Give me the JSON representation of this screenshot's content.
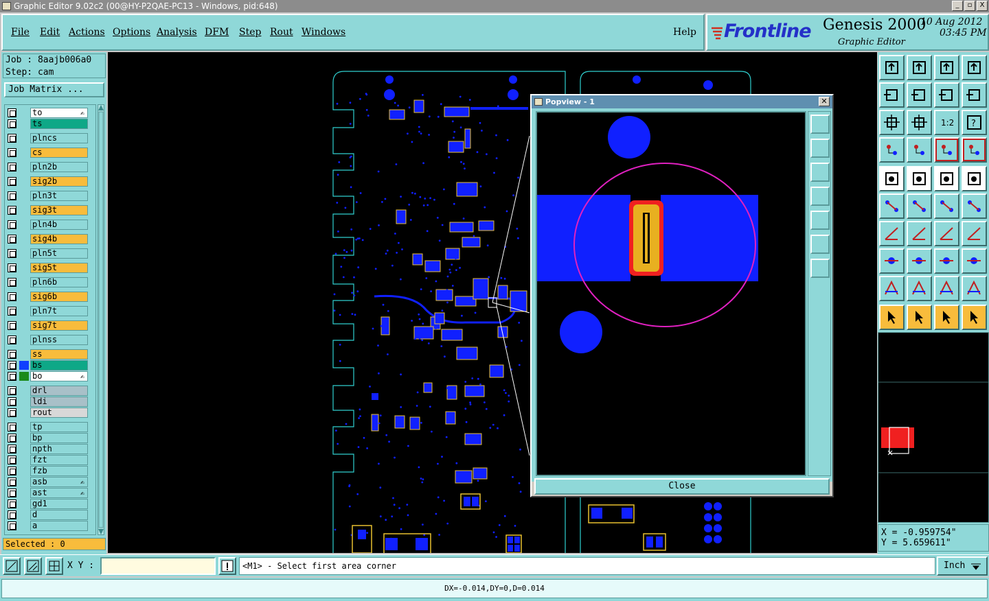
{
  "window": {
    "title": "Graphic Editor 9.02c2 (00@HY-P2QAE-PC13 - Windows, pid:648)",
    "controls": [
      "_",
      "▫",
      "X"
    ]
  },
  "menubar": {
    "items": [
      "File",
      "Edit",
      "Actions",
      "Options",
      "Analysis",
      "DFM",
      "Step",
      "Rout",
      "Windows"
    ],
    "help": "Help"
  },
  "brand": {
    "logo": "Frontline",
    "product": "Genesis 2000",
    "subtitle": "Graphic Editor",
    "date": "10 Aug 2012",
    "time": "03:45 PM"
  },
  "job": {
    "job_line": "Job : 8aajb006a0",
    "step_line": "Step: cam",
    "matrix_button": "Job Matrix ..."
  },
  "layers": [
    {
      "name": "to",
      "color": "#ffffff",
      "swatch": "",
      "mark": "✍"
    },
    {
      "name": "ts",
      "color": "#0ea887",
      "swatch": "",
      "mark": ""
    },
    {
      "name": "plncs",
      "color": "#8fd8d8",
      "swatch": "",
      "mark": ""
    },
    {
      "name": "cs",
      "color": "#f8bc3c",
      "swatch": "",
      "mark": ""
    },
    {
      "name": "pln2b",
      "color": "#8fd8d8",
      "swatch": "",
      "mark": ""
    },
    {
      "name": "sig2b",
      "color": "#f8bc3c",
      "swatch": "",
      "mark": ""
    },
    {
      "name": "pln3t",
      "color": "#8fd8d8",
      "swatch": "",
      "mark": ""
    },
    {
      "name": "sig3t",
      "color": "#f8bc3c",
      "swatch": "",
      "mark": ""
    },
    {
      "name": "pln4b",
      "color": "#8fd8d8",
      "swatch": "",
      "mark": ""
    },
    {
      "name": "sig4b",
      "color": "#f8bc3c",
      "swatch": "",
      "mark": ""
    },
    {
      "name": "pln5t",
      "color": "#8fd8d8",
      "swatch": "",
      "mark": ""
    },
    {
      "name": "sig5t",
      "color": "#f8bc3c",
      "swatch": "",
      "mark": ""
    },
    {
      "name": "pln6b",
      "color": "#8fd8d8",
      "swatch": "",
      "mark": ""
    },
    {
      "name": "sig6b",
      "color": "#f8bc3c",
      "swatch": "",
      "mark": ""
    },
    {
      "name": "pln7t",
      "color": "#8fd8d8",
      "swatch": "",
      "mark": ""
    },
    {
      "name": "sig7t",
      "color": "#f8bc3c",
      "swatch": "",
      "mark": ""
    },
    {
      "name": "plnss",
      "color": "#8fd8d8",
      "swatch": "",
      "mark": ""
    },
    {
      "name": "ss",
      "color": "#f8bc3c",
      "swatch": "",
      "mark": ""
    },
    {
      "name": "bs",
      "color": "#0ea887",
      "swatch": "#1040ff",
      "mark": ""
    },
    {
      "name": "bo",
      "color": "#ffffff",
      "swatch": "#1a8a1a",
      "mark": "✍"
    },
    {
      "name": "drl",
      "color": "#a8c0c8",
      "swatch": "",
      "mark": ""
    },
    {
      "name": "ldi",
      "color": "#a8c0c8",
      "swatch": "",
      "mark": ""
    },
    {
      "name": "rout",
      "color": "#d8d8d8",
      "swatch": "",
      "mark": ""
    },
    {
      "name": "tp",
      "color": "#8fd8d8",
      "swatch": "",
      "mark": ""
    },
    {
      "name": "bp",
      "color": "#8fd8d8",
      "swatch": "",
      "mark": ""
    },
    {
      "name": "npth",
      "color": "#8fd8d8",
      "swatch": "",
      "mark": ""
    },
    {
      "name": "fzt",
      "color": "#8fd8d8",
      "swatch": "",
      "mark": ""
    },
    {
      "name": "fzb",
      "color": "#8fd8d8",
      "swatch": "",
      "mark": ""
    },
    {
      "name": "asb",
      "color": "#8fd8d8",
      "swatch": "",
      "mark": "✍"
    },
    {
      "name": "ast",
      "color": "#8fd8d8",
      "swatch": "",
      "mark": "✍"
    },
    {
      "name": "gd1",
      "color": "#8fd8d8",
      "swatch": "",
      "mark": ""
    },
    {
      "name": "d",
      "color": "#8fd8d8",
      "swatch": "",
      "mark": ""
    },
    {
      "name": "a",
      "color": "#8fd8d8",
      "swatch": "",
      "mark": ""
    }
  ],
  "selected_label": "Selected : 0",
  "popview": {
    "title": "Popview - 1",
    "close_label": "Close"
  },
  "coords": {
    "x": "X = -0.959754\"",
    "y": "Y = 5.659611\""
  },
  "bottombar": {
    "xy_label": "X Y :",
    "xy_value": "",
    "prompt": "<M1> - Select first area corner",
    "unit": "Inch"
  },
  "status": "DX=-0.014,DY=0,D=0.014",
  "colors": {
    "panel": "#8fd8d8",
    "copper": "#1020ff",
    "silk": "#e8c030",
    "board_outline": "#30d0d0"
  }
}
